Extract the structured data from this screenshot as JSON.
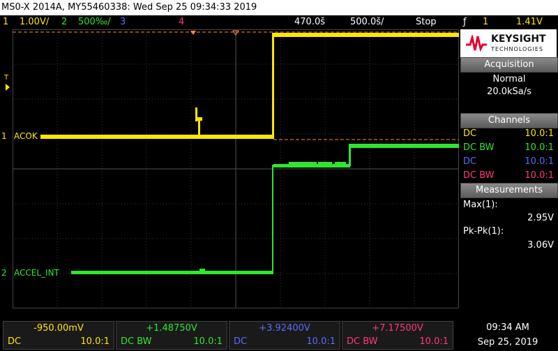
{
  "title": "MS0-X 2014A, MY55460338: Wed Sep 25 09:34:33 2019",
  "status": {
    "ch1_num": "1",
    "ch1_scale": "1.00V/",
    "ch2_num": "2",
    "ch2_scale": "500‰/",
    "ch3_num": "3",
    "ch4_num": "4",
    "time_offset": "470.0š",
    "time_scale": "500.0š/",
    "run_state": "Stop",
    "trigger_symbol": "ƒ",
    "trigger_ch": "1",
    "trigger_level": "1.41V"
  },
  "traces": {
    "ch1_marker": "1",
    "ch1_label": "ACOK",
    "ch2_marker": "2",
    "ch2_label": "ACCEL_INT",
    "trigger_marker": "T"
  },
  "brand": {
    "name": "KEYSIGHT",
    "sub": "TECHNOLOGIES"
  },
  "acquisition": {
    "header": "Acquisition",
    "mode": "Normal",
    "rate": "20.0kSa/s"
  },
  "channels": {
    "header": "Channels",
    "rows": [
      {
        "coupling": "DC",
        "probe": "10.0:1"
      },
      {
        "coupling": "DC BW",
        "probe": "10.0:1"
      },
      {
        "coupling": "DC",
        "probe": "10.0:1"
      },
      {
        "coupling": "DC BW",
        "probe": "10.0:1"
      }
    ]
  },
  "measurements": {
    "header": "Measurements",
    "m1_label": "Max(1):",
    "m1_value": "2.95V",
    "m2_label": "Pk-Pk(1):",
    "m2_value": "3.06V"
  },
  "bottom": {
    "ch1": {
      "offset": "-950.00mV",
      "coupling": "DC",
      "probe": "10.0:1"
    },
    "ch2": {
      "offset": "+1.48750V",
      "coupling": "DC  BW",
      "probe": "10.0:1"
    },
    "ch3": {
      "offset": "+3.92400V",
      "coupling": "DC",
      "probe": "10.0:1"
    },
    "ch4": {
      "offset": "+7.17500V",
      "coupling": "DC  BW",
      "probe": "10.0:1"
    }
  },
  "clock": {
    "time": "09:34 AM",
    "date": "Sep 25, 2019"
  },
  "colors": {
    "ch1": "#ffe600",
    "ch2": "#2ee62e",
    "ch3": "#5b6bff",
    "ch4": "#ff3a7a"
  }
}
